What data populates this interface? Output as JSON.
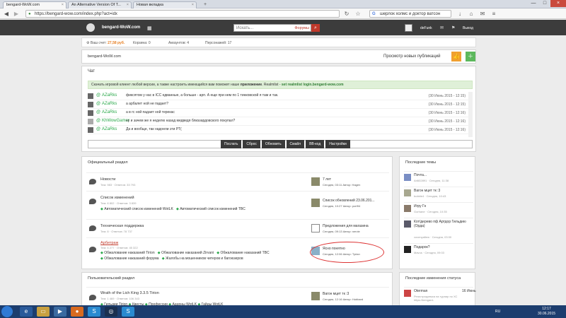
{
  "browser": {
    "tabs": [
      {
        "label": "bengard-WoW.com"
      },
      {
        "label": "An Alternative Version Of T..."
      },
      {
        "label": "Новая вкладка"
      }
    ],
    "url": "https://bengard-wow.com/index.php?act=idx",
    "search_value": "шерлок холмс и доктор ватсон"
  },
  "site": {
    "name": "bengard-WoW.com",
    "search_placeholder": "Искать...",
    "search_scope": "Форумы",
    "user": "deFunk",
    "logout": "Выход"
  },
  "stats": {
    "balance_label": "Ваш счет:",
    "balance_value": "27,58 руб.",
    "cart": "Корзина: 0",
    "accounts": "Аккаунтов: 4",
    "characters": "Персонажей: 17"
  },
  "crumbs": {
    "home": "bengard-WoW.com",
    "new_posts": "Просмотр новых публикаций"
  },
  "chat": {
    "title": "Чат",
    "notice": {
      "pre": "Скачать игровой клиент любой версии, а также настроить имеющийся вам поможет наше",
      "link": "приложение",
      "mid": ". Realmlist -",
      "realm": "set realmlist login.bengard-wow.com"
    },
    "messages": [
      {
        "user": "AZaRks",
        "text": "фиксятом у нас в ICC едванные, а больше - арп. А еще при нем по 1 тинковской я там и так.",
        "time": "(30 Июнь 2015 - 12:15)"
      },
      {
        "user": "AZaRks",
        "text": "а арбалет ной не падает?",
        "time": "(30 Июнь 2015 - 12:15)"
      },
      {
        "user": "AZaRks",
        "text": "а в гс ной падает ной терекас",
        "time": "(30 Июнь 2015 - 12:16)"
      },
      {
        "user": "KhWowGamer",
        "text": "ну и зачем же я неделю назад медведя близзардовского покупал?",
        "time": "(30 Июнь 2015 - 12:16)"
      },
      {
        "user": "AZaRks",
        "text": "Да и вообще, так надоели эти РТ(",
        "time": "(30 Июнь 2015 - 12:16)"
      }
    ],
    "buttons": {
      "send": "Послать",
      "reset": "Сброс",
      "refresh": "Обновить",
      "smile": "Смайл",
      "bbcode": "BB-код",
      "settings": "Настройки"
    }
  },
  "official": {
    "title": "Официальный раздел",
    "forums": [
      {
        "title": "Новости",
        "stats": "Тем: 983 · Ответов: 33 793",
        "last_title": "7 лет",
        "last_meta": "Сегодня, 03:11",
        "last_author": "Автор: Hagen"
      },
      {
        "title": "Список изменений",
        "stats": "Тем: 8 802 · Ответов: 3 839",
        "subs": [
          "Автоматический список изменений WotLK",
          "Автоматический список изменений TBC"
        ],
        "last_title": "Список обновлений 23.06.201...",
        "last_meta": "Сегодня, 10:27",
        "last_author": "Автор: port94"
      },
      {
        "title": "Техническая поддержка",
        "stats": "Тем: 8 · Ответов: 78 737",
        "last_title": "Предложения для магазина",
        "last_meta": "Сегодня, 09:13",
        "last_author": "Автор: nervie"
      },
      {
        "title": "Арбитраж",
        "stats": "Тем: 5 277 · Ответов: 45 322",
        "subs": [
          "Обжалование наказаний Tirion",
          "Обжалование наказаний Zirvani",
          "Обжалование наказаний TBC",
          "Обжалование наказаний форума",
          "Жалобы на мошенников читеров и багоюзеров"
        ],
        "last_title": "Ясно понятно",
        "last_meta": "Сегодня, 12:06",
        "last_author": "Автор: Tyrian"
      }
    ]
  },
  "user_section": {
    "title": "Пользовательский раздел",
    "forums": [
      {
        "title": "Wrath of the Lich King 3.3.5 Tirion",
        "stats": "Тем: 1 469 · Ответов: 106 343",
        "subs": [
          "Гильдии Tirion",
          "Квесты",
          "Профессии",
          "Аддоны WotLK",
          "Гайды WotLK"
        ],
        "last_title": "Вагон мцет тк :3",
        "last_meta": "Сегодня, 12:16",
        "last_author": "Автор: Hobbard"
      }
    ]
  },
  "latest_topics": {
    "title": "Последние темы",
    "items": [
      {
        "title": "Почта...",
        "meta": "Ari602891 · Сегодня, 11:38"
      },
      {
        "title": "Вагон мцет тк :3",
        "meta": "bubble4 · Сегодня, 10:43"
      },
      {
        "title": "Игру Гн",
        "meta": "Gorhane · Сегодня, 10:35"
      },
      {
        "title": "Кот/дерево пф Артдор Гильдию (Орда)",
        "meta": "vovenyafiew · Сегодня, 03:30"
      },
      {
        "title": "Подарок?",
        "meta": "Mavus · Сегодня, 09:03"
      }
    ]
  },
  "status": {
    "title": "Последние изменения статуса",
    "items": [
      {
        "user": "Oterman",
        "time": "16 Июнь",
        "text": "Регистрируемся на турнир по ХС https://bengard-"
      }
    ]
  },
  "taskbar": {
    "lang": "RU",
    "time": "12:17",
    "date": "30.06.2015"
  }
}
